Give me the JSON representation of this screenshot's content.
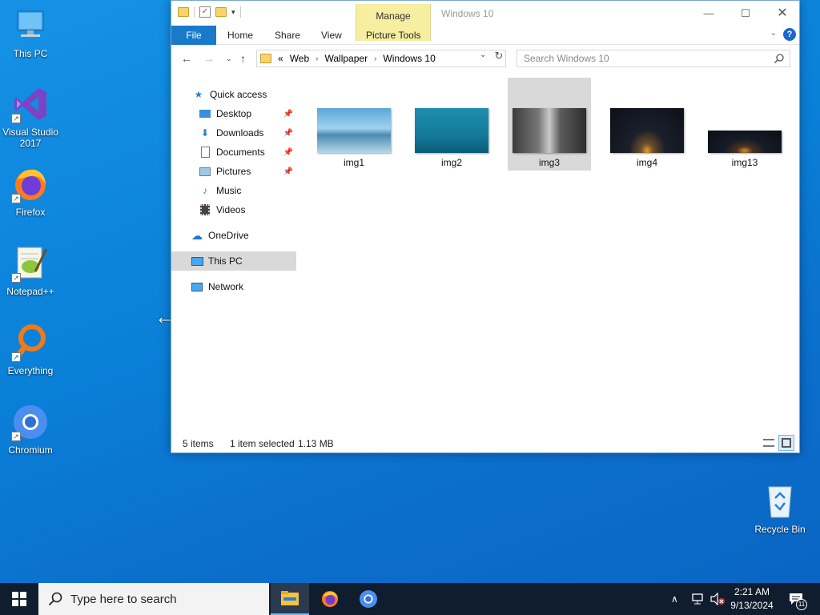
{
  "desktop": {
    "icons": [
      {
        "label": "This PC"
      },
      {
        "label": "Visual Studio 2017"
      },
      {
        "label": "Firefox"
      },
      {
        "label": "Notepad++"
      },
      {
        "label": "Everything"
      },
      {
        "label": "Chromium"
      },
      {
        "label": "Recycle Bin"
      }
    ]
  },
  "window": {
    "title": "Windows 10",
    "contextual_tab_group": "Manage",
    "ribbon_tabs": {
      "file": "File",
      "home": "Home",
      "share": "Share",
      "view": "View",
      "picture_tools": "Picture Tools"
    },
    "address": {
      "overflow": "«",
      "crumbs": [
        "Web",
        "Wallpaper",
        "Windows 10"
      ]
    },
    "search": {
      "placeholder": "Search Windows 10"
    },
    "nav": {
      "quick_access": "Quick access",
      "desktop": "Desktop",
      "downloads": "Downloads",
      "documents": "Documents",
      "pictures": "Pictures",
      "music": "Music",
      "videos": "Videos",
      "onedrive": "OneDrive",
      "this_pc": "This PC",
      "network": "Network"
    },
    "files": [
      {
        "name": "img1"
      },
      {
        "name": "img2"
      },
      {
        "name": "img3",
        "selected": true
      },
      {
        "name": "img4"
      },
      {
        "name": "img13"
      }
    ],
    "status": {
      "count": "5 items",
      "selection": "1 item selected",
      "size": "1.13 MB"
    }
  },
  "taskbar": {
    "search_placeholder": "Type here to search",
    "clock_time": "2:21 AM",
    "clock_date": "9/13/2024",
    "notification_count": "11"
  },
  "colors": {
    "desktop_bg": "#0a7fd8",
    "accent": "#1979ca",
    "manage_tab": "#f6eea0",
    "taskbar": "#101d2e"
  }
}
